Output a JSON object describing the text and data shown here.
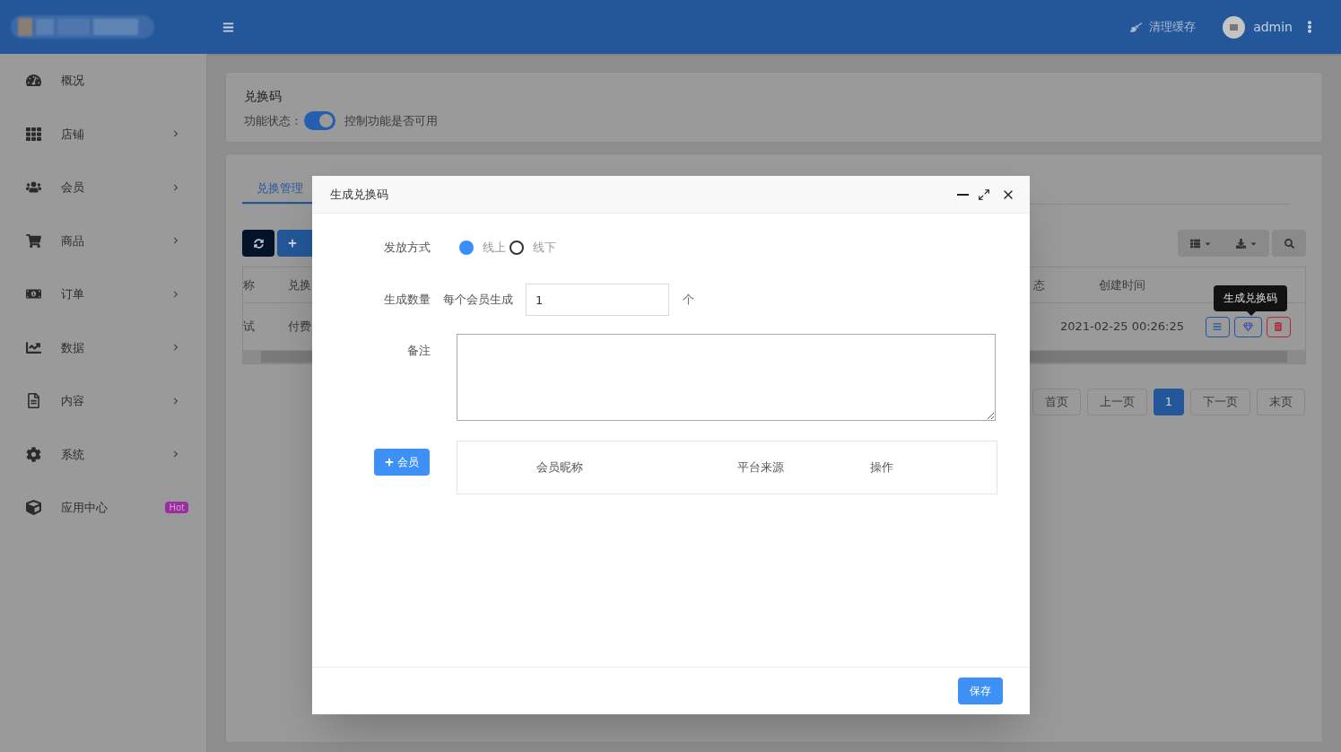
{
  "header": {
    "cache_label": "清理缓存",
    "user": "admin"
  },
  "sidebar": {
    "items": [
      {
        "label": "概况",
        "arrow": false
      },
      {
        "label": "店铺",
        "arrow": true
      },
      {
        "label": "会员",
        "arrow": true
      },
      {
        "label": "商品",
        "arrow": true
      },
      {
        "label": "订单",
        "arrow": true
      },
      {
        "label": "数据",
        "arrow": true
      },
      {
        "label": "内容",
        "arrow": true
      },
      {
        "label": "系统",
        "arrow": true
      },
      {
        "label": "应用中心",
        "arrow": false,
        "badge": "Hot"
      }
    ]
  },
  "feature": {
    "title": "兑换码",
    "status_label": "功能状态：",
    "on": true,
    "hint": "控制功能是否可用"
  },
  "tabs": [
    {
      "label": "兑换管理",
      "selected": true
    }
  ],
  "table": {
    "columns": [
      "称",
      "兑换",
      "态",
      "创建时间"
    ],
    "rows": [
      {
        "cells": [
          "试",
          "付费",
          "",
          "2021-02-25 00:26:25"
        ]
      }
    ],
    "tooltip": "生成兑换码"
  },
  "pagination": [
    {
      "label": "首页",
      "selected": false
    },
    {
      "label": "上一页",
      "selected": false
    },
    {
      "label": "1",
      "selected": true
    },
    {
      "label": "下一页",
      "selected": false
    },
    {
      "label": "末页",
      "selected": false
    }
  ],
  "modal": {
    "title": "生成兑换码",
    "method": {
      "label": "发放方式",
      "options": [
        {
          "label": "线上",
          "selected": true
        },
        {
          "label": "线下",
          "selected": false
        }
      ]
    },
    "quantity": {
      "label": "生成数量",
      "prefix": "每个会员生成",
      "value": "1",
      "suffix": "个"
    },
    "note": {
      "label": "备注"
    },
    "add_member": "会员",
    "member_columns": [
      "会员昵称",
      "平台来源",
      "操作"
    ],
    "save": "保存"
  }
}
